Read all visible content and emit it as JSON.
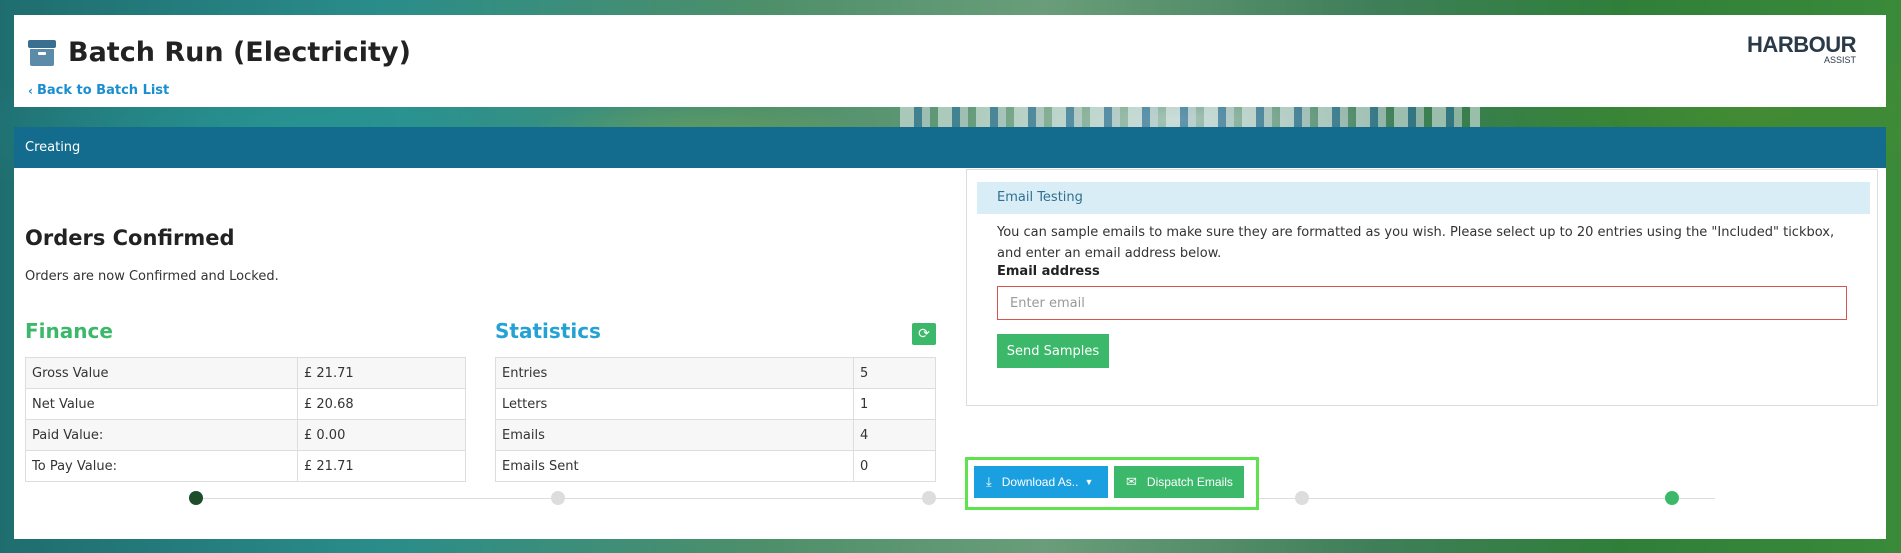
{
  "header": {
    "title": "Batch Run (Electricity)",
    "back_link": "Back to Batch List",
    "logo_line1": "HARBOUR",
    "logo_line2": "ASSIST"
  },
  "panel": {
    "heading": "Creating"
  },
  "orders": {
    "title": "Orders Confirmed",
    "text": "Orders are now Confirmed and Locked."
  },
  "finance": {
    "title": "Finance",
    "rows": [
      {
        "label": "Gross Value",
        "value": "£ 21.71"
      },
      {
        "label": "Net Value",
        "value": "£ 20.68"
      },
      {
        "label": "Paid Value:",
        "value": "£ 0.00"
      },
      {
        "label": "To Pay Value:",
        "value": "£ 21.71"
      }
    ]
  },
  "statistics": {
    "title": "Statistics",
    "rows": [
      {
        "label": "Entries",
        "value": "5"
      },
      {
        "label": "Letters",
        "value": "1"
      },
      {
        "label": "Emails",
        "value": "4"
      },
      {
        "label": "Emails Sent",
        "value": "0"
      }
    ]
  },
  "email_testing": {
    "heading": "Email Testing",
    "description": "You can sample emails to make sure they are formatted as you wish. Please select up to 20 entries using the \"Included\" tickbox, and enter an email address below.",
    "label": "Email address",
    "placeholder": "Enter email",
    "send_label": "Send Samples"
  },
  "actions": {
    "download_label": "Download As..",
    "dispatch_label": "Dispatch Emails"
  },
  "progress": {
    "steps": [
      "done",
      "todo",
      "todo",
      "todo",
      "todo",
      "active"
    ]
  },
  "colors": {
    "primary_header": "#136c8e",
    "success": "#3cb86a",
    "info": "#1a9fe0",
    "highlight": "#5ee34f"
  }
}
